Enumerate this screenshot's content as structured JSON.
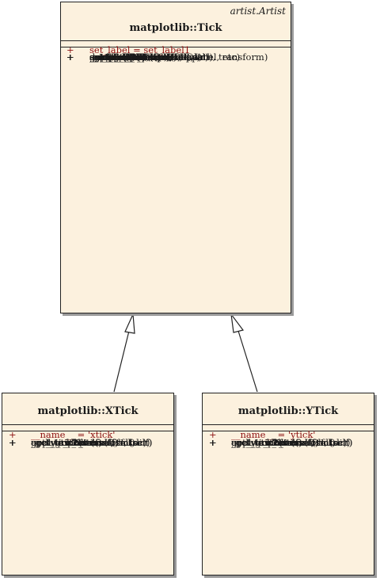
{
  "tick": {
    "stereotype": "artist.Artist",
    "name": "matplotlib::Tick",
    "attributes": [
      {
        "vis": "+",
        "text": "set_label = set_label1"
      }
    ],
    "operations": [
      {
        "vis": "+",
        "text": "__init__(self, axes, loc, label, etc)"
      },
      {
        "vis": "+",
        "text": "_apply_params(self, kw)"
      },
      {
        "vis": "+",
        "text": "_get_gridline(self)"
      },
      {
        "vis": "+",
        "text": "_get_text1(self)"
      },
      {
        "vis": "+",
        "text": "_get_text2(self)"
      },
      {
        "vis": "+",
        "text": "_get_tick1line(self)"
      },
      {
        "vis": "+",
        "text": "_get_tick2line(self)"
      },
      {
        "vis": "+",
        "text": "_set_artist_props(self, a)"
      },
      {
        "vis": "+",
        "text": "apply_tickdir(self, tickdir)"
      },
      {
        "vis": "+",
        "text": "contains(self, mouseevent)"
      },
      {
        "vis": "+",
        "text": "draw(self, renderer)"
      },
      {
        "vis": "+",
        "text": "get_children(self)"
      },
      {
        "vis": "+",
        "text": "get_loc(self)"
      },
      {
        "vis": "+",
        "text": "get_pad(self)"
      },
      {
        "vis": "+",
        "text": "get_pad_pixels(self)"
      },
      {
        "vis": "+",
        "text": "get_view_interval(self)"
      },
      {
        "vis": "+",
        "text": "set_clip_path(self, clippath, transform)"
      },
      {
        "vis": "+",
        "text": "set_label1(self, s)"
      },
      {
        "vis": "+",
        "text": "set_label2(self, s)"
      },
      {
        "vis": "+",
        "text": "set_pad(self, val)"
      }
    ]
  },
  "xtick": {
    "name": "matplotlib::XTick",
    "attributes": [
      {
        "vis": "+",
        "text": "__name__ = 'xtick'"
      }
    ],
    "operations": [
      {
        "vis": "+",
        "text": "_get_gridline(self)"
      },
      {
        "vis": "+",
        "text": "_get_text1(self)"
      },
      {
        "vis": "+",
        "text": "_get_text1_transform(self)"
      },
      {
        "vis": "+",
        "text": "_get_text2(self)"
      },
      {
        "vis": "+",
        "text": "_get_text2_transform(self)"
      },
      {
        "vis": "+",
        "text": "_get_tick1line(self)"
      },
      {
        "vis": "+",
        "text": "_get_tick2line(self)"
      },
      {
        "vis": "+",
        "text": "apply_tickdir(self, tickdir)"
      },
      {
        "vis": "+",
        "text": "get_view_interval(self)"
      },
      {
        "vis": "+",
        "text": "update_position(self, loc)"
      }
    ]
  },
  "ytick": {
    "name": "matplotlib::YTick",
    "attributes": [
      {
        "vis": "+",
        "text": "__name__ = 'ytick'"
      }
    ],
    "operations": [
      {
        "vis": "+",
        "text": "_get_gridline(self)"
      },
      {
        "vis": "+",
        "text": "_get_text1(self)"
      },
      {
        "vis": "+",
        "text": "_get_text1_transform(self)"
      },
      {
        "vis": "+",
        "text": "_get_text2(self)"
      },
      {
        "vis": "+",
        "text": "_get_text2_transform(self)"
      },
      {
        "vis": "+",
        "text": "_get_tick1line(self)"
      },
      {
        "vis": "+",
        "text": "_get_tick2line(self)"
      },
      {
        "vis": "+",
        "text": "apply_tickdir(self, tickdir)"
      },
      {
        "vis": "+",
        "text": "get_view_interval(self)"
      },
      {
        "vis": "+",
        "text": "update_position(self, loc)"
      }
    ]
  },
  "colors": {
    "class_fill": "#fcf1de",
    "attribute_text": "#8b1010",
    "border": "#222222"
  }
}
